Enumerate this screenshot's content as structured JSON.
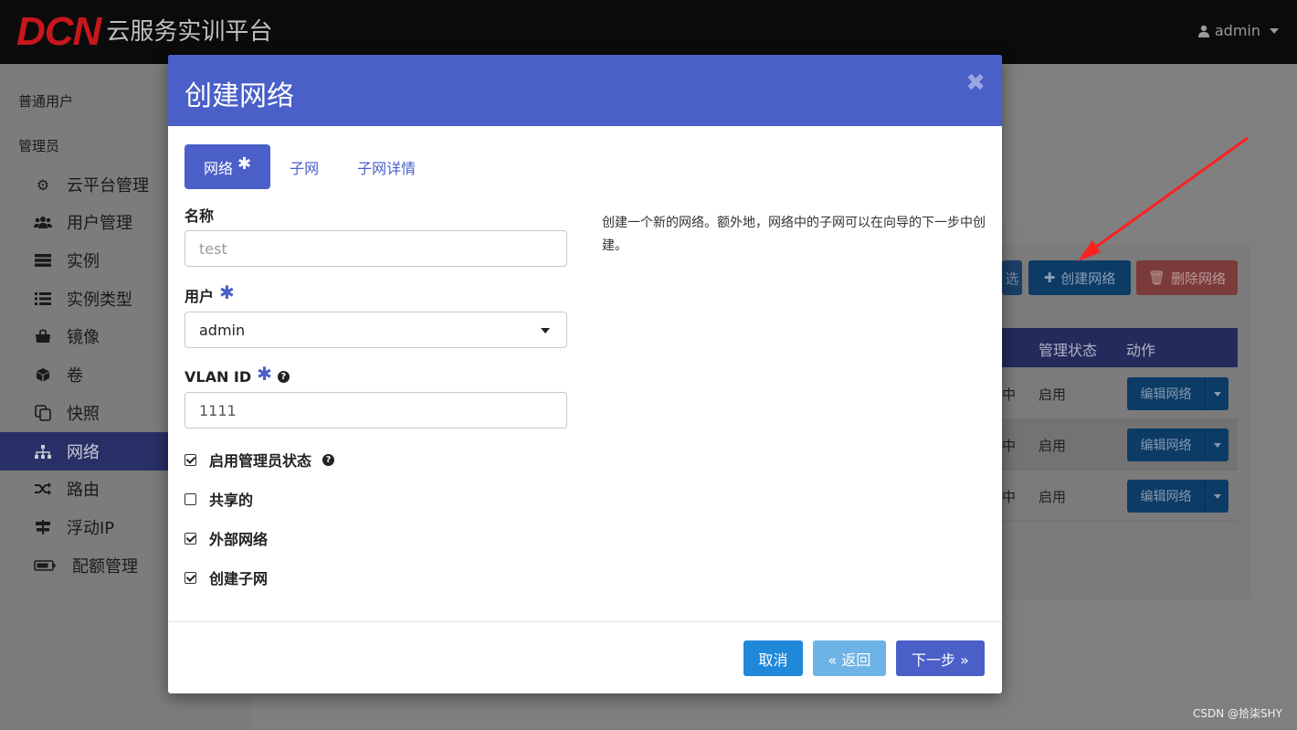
{
  "brand": {
    "logo_mark": "DCN",
    "title": "云服务实训平台"
  },
  "user_menu": {
    "label": "admin"
  },
  "sidebar": {
    "sections": [
      "普通用户",
      "管理员"
    ],
    "items": [
      {
        "label": "云平台管理",
        "icon": "cogs-icon"
      },
      {
        "label": "用户管理",
        "icon": "users-icon"
      },
      {
        "label": "实例",
        "icon": "server-icon"
      },
      {
        "label": "实例类型",
        "icon": "list-icon"
      },
      {
        "label": "镜像",
        "icon": "image-icon"
      },
      {
        "label": "卷",
        "icon": "cube-icon"
      },
      {
        "label": "快照",
        "icon": "copy-icon"
      },
      {
        "label": "网络",
        "icon": "sitemap-icon",
        "active": true
      },
      {
        "label": "路由",
        "icon": "random-icon"
      },
      {
        "label": "浮动IP",
        "icon": "signpost-icon"
      },
      {
        "label": "配额管理",
        "icon": "battery-icon"
      }
    ]
  },
  "background": {
    "filter_btn": "选",
    "create_btn": "创建网络",
    "delete_btn": "删除网络",
    "columns": [
      "管理状态",
      "动作"
    ],
    "rows": [
      {
        "c1": "中",
        "status": "启用",
        "action": "编辑网络"
      },
      {
        "c1": "中",
        "status": "启用",
        "action": "编辑网络"
      },
      {
        "c1": "中",
        "status": "启用",
        "action": "编辑网络"
      }
    ]
  },
  "modal": {
    "title": "创建网络",
    "close": "✖",
    "tabs": [
      {
        "label": "网络",
        "required": "✱",
        "active": true
      },
      {
        "label": "子网"
      },
      {
        "label": "子网详情"
      }
    ],
    "fields": {
      "name_label": "名称",
      "name_placeholder": "test",
      "user_label": "用户",
      "user_value": "admin",
      "vlan_label": "VLAN ID",
      "vlan_value": "1111",
      "required_mark": "✱"
    },
    "checkboxes": [
      {
        "label": "启用管理员状态",
        "checked": true,
        "help": true
      },
      {
        "label": "共享的",
        "checked": false
      },
      {
        "label": "外部网络",
        "checked": true
      },
      {
        "label": "创建子网",
        "checked": true
      }
    ],
    "description": "创建一个新的网络。额外地，网络中的子网可以在向导的下一步中创建。",
    "buttons": {
      "cancel": "取消",
      "back": "« 返回",
      "next": "下一步 »"
    }
  },
  "watermark": "CSDN @拾柒SHY",
  "colors": {
    "primary": "#4a5fc8",
    "info": "#1f88d9",
    "danger": "#d9534f"
  }
}
